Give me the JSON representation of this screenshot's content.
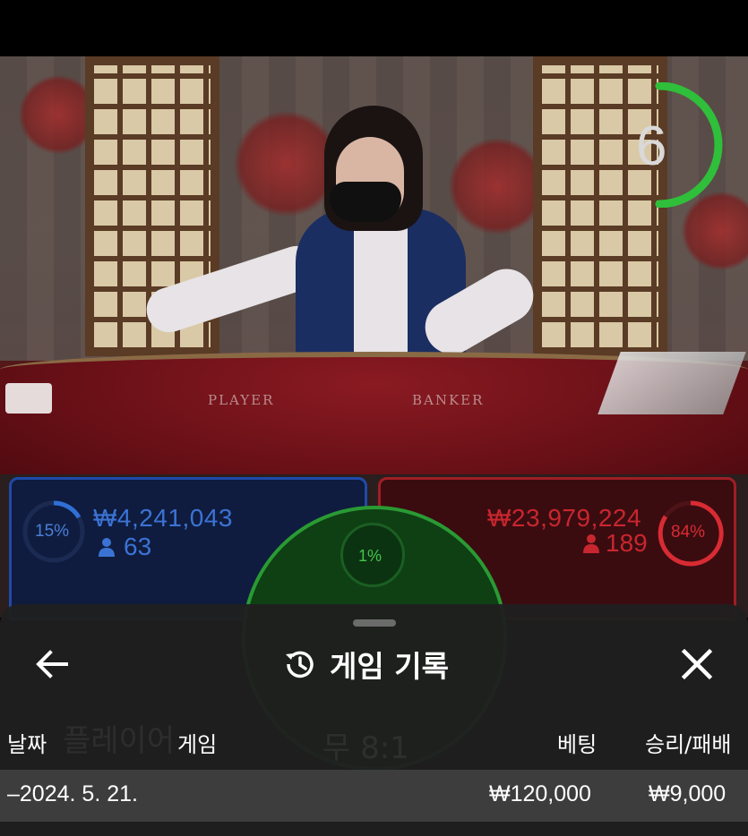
{
  "timer": {
    "seconds": "6",
    "color": "#2fbf3a"
  },
  "table": {
    "player_label": "PLAYER",
    "banker_label": "BANKER"
  },
  "player": {
    "percent": "15%",
    "amount": "₩4,241,043",
    "players": "63",
    "color": "#2f6fd6"
  },
  "banker": {
    "percent": "84%",
    "amount": "₩23,979,224",
    "players": "189",
    "color": "#d92b33"
  },
  "tie": {
    "percent": "1%",
    "color": "#46c24c"
  },
  "sheet": {
    "title": "게임 기록",
    "icons": {
      "back": "arrow-left-icon",
      "history": "history-icon",
      "close": "close-icon"
    },
    "columns": {
      "date": "날짜",
      "game": "게임",
      "bet": "베팅",
      "result": "승리/패배"
    },
    "rows": [
      {
        "date": "–2024. 5. 21.",
        "game": "",
        "bet": "₩120,000",
        "result": "₩9,000"
      }
    ]
  }
}
